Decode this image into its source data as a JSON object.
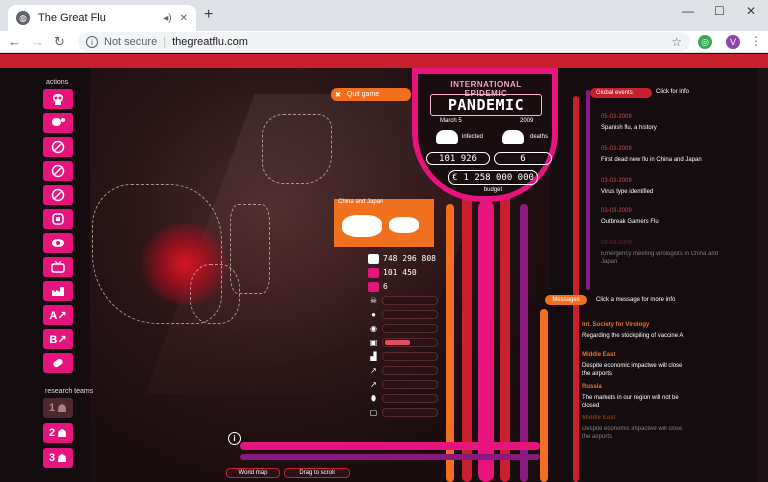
{
  "browser": {
    "tab_title": "The Great Flu",
    "tab_fav_icon": "globe-icon",
    "tab_audio_icon": "speaker-icon",
    "tab_close": "✕",
    "new_tab": "+",
    "minimize": "—",
    "maximize": "☐",
    "close": "✕",
    "nav_back": "←",
    "nav_forward": "→",
    "nav_reload": "↻",
    "security": "Not secure",
    "url": "thegreatflu.com",
    "profile_initial": "V"
  },
  "game": {
    "actions_label": "actions",
    "research_label": "research teams",
    "teams": [
      "1",
      "2",
      "3"
    ],
    "quit_label": "Quit game",
    "pandemic": {
      "superscript": "INTERNATIONAL EPIDEMIC",
      "title": "PANDEMIC",
      "date": "March 5",
      "year": "2009",
      "infected_label": "infected",
      "deaths_label": "deaths",
      "infected_value": "101 926",
      "deaths_value": "6",
      "currency": "€",
      "budget_value": "1 258 000 000",
      "budget_label": "budget"
    },
    "region_label": "China and Japan",
    "stats": {
      "population": "748 296 808",
      "infected": "101 450",
      "deaths": "6"
    },
    "controls_progress": [
      0,
      0,
      0,
      0.5,
      0,
      0,
      0
    ],
    "global_events": {
      "header": "Global events",
      "info": "Click for info",
      "items": [
        {
          "date": "05-03-2009",
          "text": "Spanish flu, a history"
        },
        {
          "date": "05-03-2009",
          "text": "First dead new flu in China and Japan"
        },
        {
          "date": "03-03-2009",
          "text": "Virus type identified"
        },
        {
          "date": "03-03-2009",
          "text": "Outbreak Gamers Flu"
        },
        {
          "date": "03-03-2009",
          "text": "Emergency meeting virologists in China and Japan"
        }
      ]
    },
    "messages": {
      "header": "Messages",
      "info": "Click a message for more info",
      "items": [
        {
          "source": "Int. Society for Virology",
          "text": "Regarding the stockpiling of vaccine A"
        },
        {
          "source": "Middle East",
          "text": "Despite economic impactwe will close the airports"
        },
        {
          "source": "Russia",
          "text": "The markets in our region will not be closed"
        },
        {
          "source": "Middle East",
          "text": "Despite economic impactwe will close the airports"
        }
      ]
    },
    "info_button": "i",
    "bottom_tabs": [
      "World map",
      "Drag to scroll"
    ]
  }
}
